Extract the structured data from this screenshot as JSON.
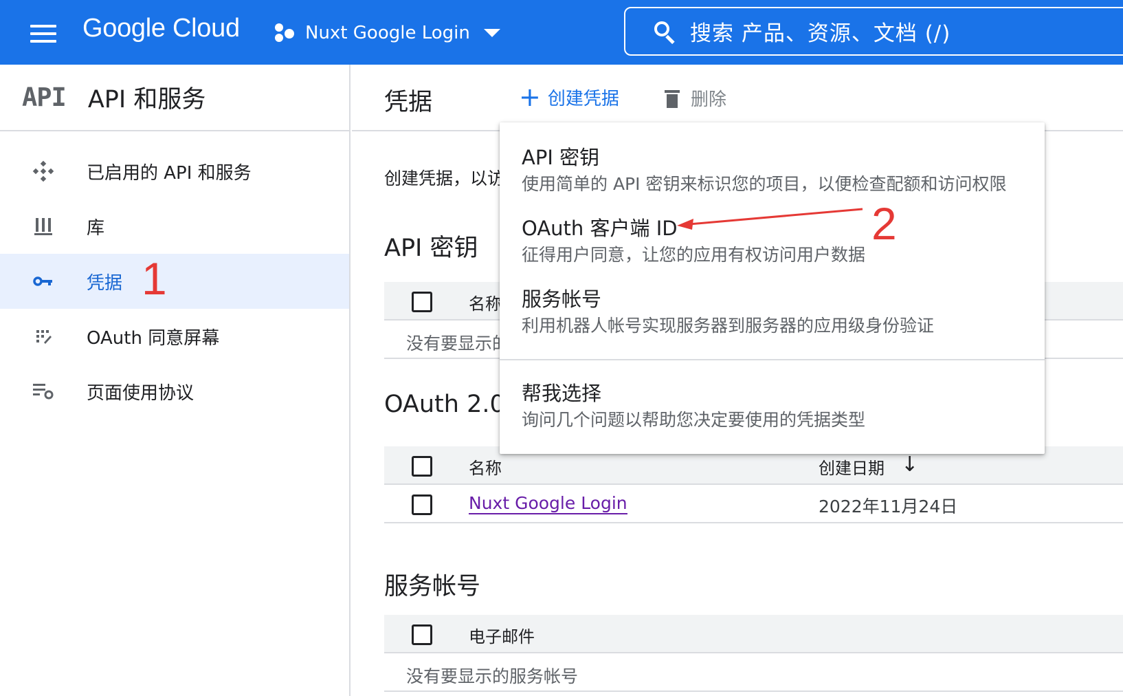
{
  "topbar": {
    "brand": "Google Cloud",
    "project_name": "Nuxt Google Login",
    "search_placeholder": "搜索  产品、资源、文档 (/)"
  },
  "sidebar": {
    "logo": "API",
    "title": "API 和服务",
    "items": [
      {
        "label": "已启用的 API 和服务",
        "icon": "apis-icon",
        "active": false
      },
      {
        "label": "库",
        "icon": "library-icon",
        "active": false
      },
      {
        "label": "凭据",
        "icon": "key-icon",
        "active": true
      },
      {
        "label": "OAuth 同意屏幕",
        "icon": "consent-icon",
        "active": false
      },
      {
        "label": "页面使用协议",
        "icon": "settings-list-icon",
        "active": false
      }
    ]
  },
  "main": {
    "title": "凭据",
    "create_label": "创建凭据",
    "delete_label": "删除",
    "intro": "创建凭据，以访",
    "api_keys": {
      "title": "API 密钥",
      "col_name": "名称",
      "empty": "没有要显示的"
    },
    "oauth": {
      "title": "OAuth 2.0",
      "col_name": "名称",
      "col_date": "创建日期",
      "rows": [
        {
          "name": "Nuxt Google Login",
          "date": "2022年11月24日"
        }
      ]
    },
    "service_accounts": {
      "title": "服务帐号",
      "col_email": "电子邮件",
      "empty": "没有要显示的服务帐号"
    }
  },
  "menu": {
    "items": [
      {
        "title": "API 密钥",
        "desc": "使用简单的 API 密钥来标识您的项目，以便检查配额和访问权限"
      },
      {
        "title": "OAuth 客户端 ID",
        "desc": "征得用户同意，让您的应用有权访问用户数据"
      },
      {
        "title": "服务帐号",
        "desc": "利用机器人帐号实现服务器到服务器的应用级身份验证"
      },
      {
        "title": "帮我选择",
        "desc": "询问几个问题以帮助您决定要使用的凭据类型"
      }
    ]
  },
  "annotations": {
    "step1": "1",
    "step2": "2",
    "color": "#e53935"
  },
  "colors": {
    "accent": "#1a73e8",
    "active_bg": "#e8f0fe",
    "link_visited": "#681da8"
  }
}
